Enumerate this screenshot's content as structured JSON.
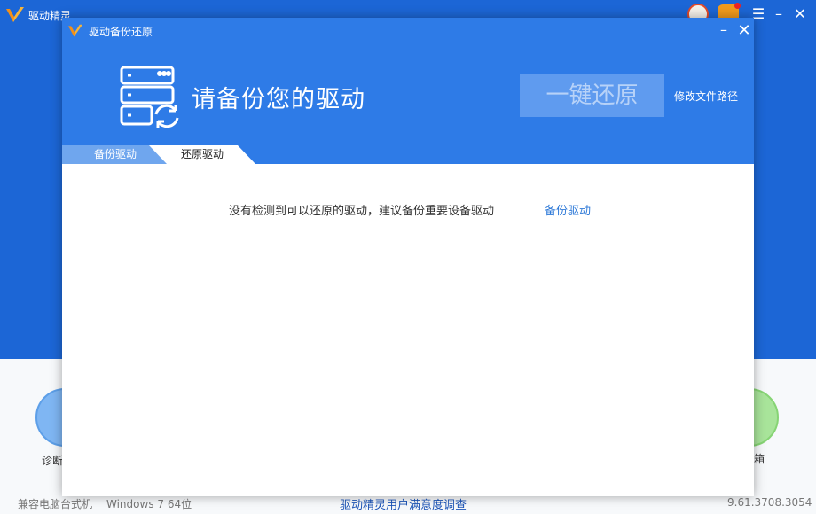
{
  "app": {
    "title": "驱动精灵",
    "menu_glyph": "☰",
    "minimize_glyph": "–",
    "close_glyph": "✕",
    "left_feature_label": "诊断",
    "right_feature_label": "箱"
  },
  "status": {
    "pc_type": "兼容电脑台式机",
    "os": "Windows 7 64位",
    "survey_link": "驱动精灵用户满意度调查",
    "version": "9.61.3708.3054"
  },
  "dialog": {
    "title": "驱动备份还原",
    "minimize_glyph": "–",
    "close_glyph": "✕",
    "headline": "请备份您的驱动",
    "restore_button": "一键还原",
    "change_path": "修改文件路径",
    "tabs": [
      {
        "label": "备份驱动",
        "active": false
      },
      {
        "label": "还原驱动",
        "active": true
      }
    ],
    "empty_message": "没有检测到可以还原的驱动，建议备份重要设备驱动",
    "backup_link": "备份驱动"
  },
  "colors": {
    "app_blue": "#1c66d6",
    "dialog_blue": "#2e7be7",
    "link_blue": "#2f7ad8",
    "logo_orange": "#f39019"
  },
  "icons": {
    "app_logo": "v-logo-icon",
    "server": "server-restore-icon",
    "avatar": "user-avatar-icon",
    "game": "gamepad-icon"
  }
}
